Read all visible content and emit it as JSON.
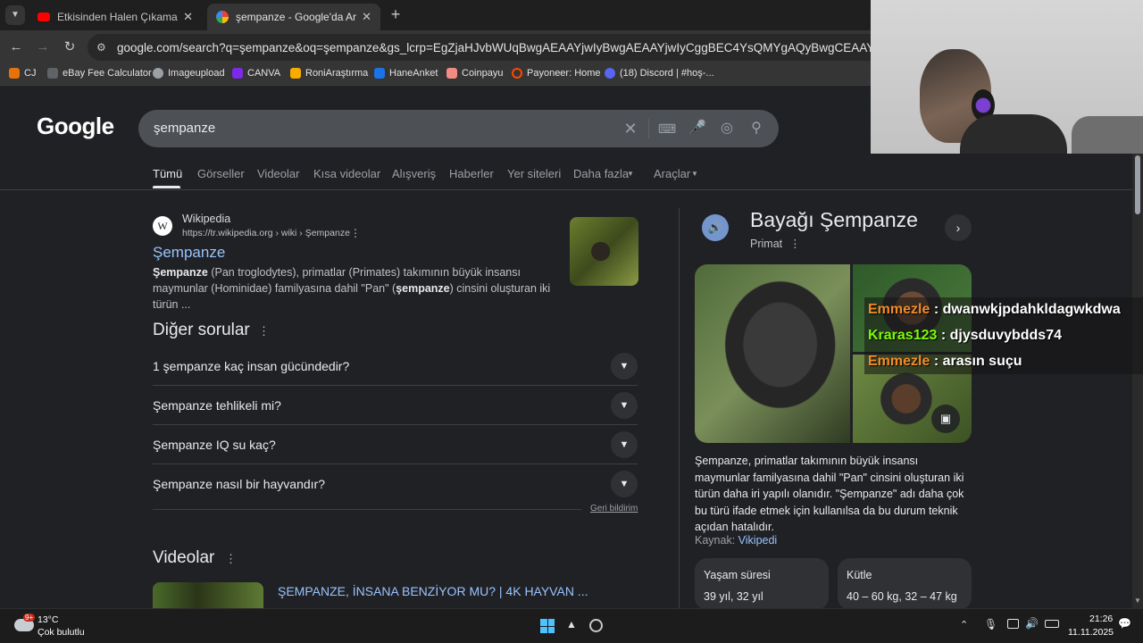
{
  "browser": {
    "tabs": [
      {
        "title": "Etkisinden Halen Çıkamadığım",
        "active": false
      },
      {
        "title": "şempanze - Google'da Ara",
        "active": true
      }
    ],
    "url": "google.com/search?q=şempanze&oq=şempanze&gs_lcrp=EgZjaHJvbWUqBwgAEAAYjwIyBwgAEAAYjwIyCggBEC4YsQMYgAQyBwgCEAAYgAQyBwgDEAAYgAQyBwgE",
    "bookmarks": [
      "CJ",
      "eBay Fee Calculator",
      "Imageupload",
      "CANVA",
      "RoniAraştırma",
      "HaneAnket",
      "Coinpayu",
      "Payoneer: Home",
      "(18) Discord | #hoş-..."
    ]
  },
  "google": {
    "logo": "Google",
    "query": "şempanze",
    "tabs": [
      "Tümü",
      "Görseller",
      "Videolar",
      "Kısa videolar",
      "Alışveriş",
      "Haberler",
      "Yer siteleri",
      "Daha fazla",
      "Araçlar"
    ],
    "result": {
      "site": "Wikipedia",
      "breadcrumb": "https://tr.wikipedia.org › wiki › Şempanze",
      "title": "Şempanze",
      "snippet_bold1": "Şempanze",
      "snippet_1": " (Pan troglodytes), primatlar (Primates) takımının büyük insansı maymunlar (Hominidae) familyasına dahil \"Pan\" (",
      "snippet_bold2": "şempanze",
      "snippet_2": ") cinsini oluşturan iki türün ..."
    },
    "paa": {
      "heading": "Diğer sorular",
      "questions": [
        "1 şempanze kaç insan gücündedir?",
        "Şempanze tehlikeli mi?",
        "Şempanze IQ su kaç?",
        "Şempanze nasıl bir hayvandır?"
      ],
      "feedback": "Geri bildirim"
    },
    "videos": {
      "heading": "Videolar",
      "first_title": "ŞEMPANZE, İNSANA BENZİYOR MU? | 4K HAYVAN ..."
    }
  },
  "knowledge_panel": {
    "title": "Bayağı Şempanze",
    "subtitle": "Primat",
    "description": "Şempanze, primatlar takımının büyük insansı maymunlar familyasına dahil \"Pan\" cinsini oluşturan iki türün daha iri yapılı olanıdır. \"Şempanze\" adı daha çok bu türü ifade etmek için kullanılsa da bu durum teknik açıdan hatalıdır.",
    "source_label": "Kaynak:",
    "source_link": "Vikipedi",
    "facts": [
      {
        "label": "Yaşam süresi",
        "value": "39 yıl, 32 yıl"
      },
      {
        "label": "Kütle",
        "value": "40 – 60 kg, 32 – 47 kg"
      }
    ]
  },
  "chat": [
    {
      "user": "Emmezle",
      "message": " : dwanwkjpdahkldagwkdwa",
      "color": "#f28c28"
    },
    {
      "user": "Kraras123",
      "message": " : djysduvybdds74",
      "color": "#7cfc00"
    },
    {
      "user": "Emmezle",
      "message": " : arasın suçu",
      "color": "#f28c28"
    }
  ],
  "taskbar": {
    "weather_temp": "13°C",
    "weather_desc": "Çok bulutlu",
    "weather_badge": "9+",
    "time": "21:26",
    "date": "11.11.2025"
  }
}
